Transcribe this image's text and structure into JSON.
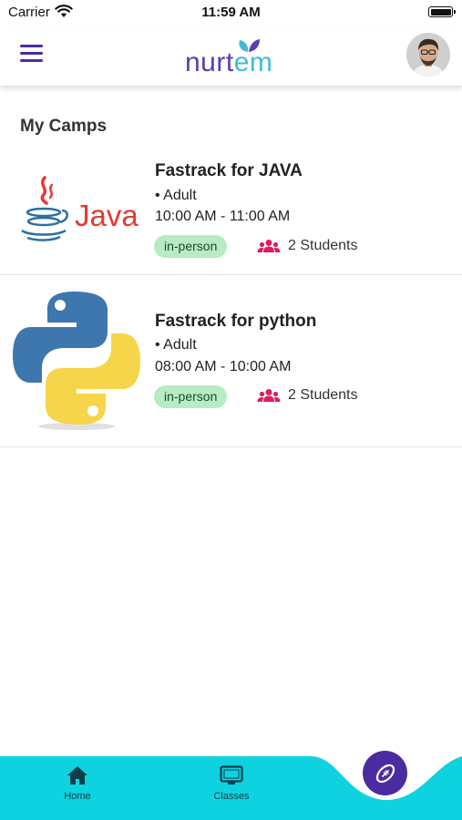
{
  "status_bar": {
    "carrier": "Carrier",
    "time": "11:59 AM"
  },
  "header": {
    "logo_text": "nurt",
    "logo_suffix": "em",
    "menu_icon": "hamburger-menu-icon",
    "avatar_icon": "user-avatar"
  },
  "main": {
    "section_title": "My Camps",
    "camps": [
      {
        "title": "Fastrack for JAVA",
        "audience": "• Adult",
        "time": "10:00 AM - 11:00 AM",
        "mode": "in-person",
        "students": "2 Students",
        "logo_icon": "java-logo",
        "logo_text": "Java"
      },
      {
        "title": "Fastrack for python",
        "audience": "• Adult",
        "time": "08:00 AM - 10:00 AM",
        "mode": "in-person",
        "students": "2 Students",
        "logo_icon": "python-logo"
      }
    ]
  },
  "bottom_nav": {
    "items": [
      {
        "label": "Home",
        "icon": "home-icon"
      },
      {
        "label": "Classes",
        "icon": "monitor-icon"
      }
    ],
    "fab_icon": "football-icon"
  },
  "colors": {
    "brand_purple": "#4b2ba1",
    "brand_teal": "#3fbcd4",
    "nav_teal": "#0fd2e0",
    "badge_green": "#b6ebc4",
    "students_icon": "#e01b63"
  }
}
